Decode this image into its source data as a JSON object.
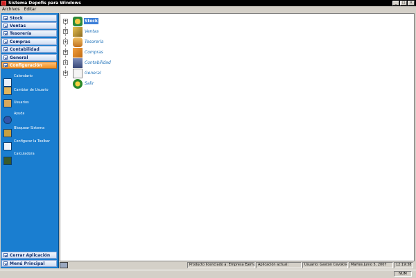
{
  "window": {
    "title": "Sistema Depofis para Windows"
  },
  "menu": {
    "items": [
      "Archivos",
      "Editar"
    ]
  },
  "sidebar": {
    "groups_top": [
      "Stock",
      "Ventas",
      "Tesorería",
      "Compras",
      "Contabilidad",
      "General",
      "Configuración"
    ],
    "items": [
      "Calendario",
      "Cambiar de Usuario",
      "Usuarios",
      "Ayuda",
      "Bloquear Sistema",
      "Configurar la Toolbar",
      "Calculadora"
    ],
    "groups_bottom": [
      "Cerrar Aplicación",
      "Menú Principal"
    ]
  },
  "tree": {
    "nodes": [
      "Stock",
      "Ventas",
      "Tesorería",
      "Compras",
      "Contabilidad",
      "General",
      "Salir"
    ],
    "selected": "Stock"
  },
  "status": {
    "license": "Producto licenciado a: Empresa Ejemplo S.A.",
    "app": "Aplicación actual:",
    "user": "Usuario: Gaston Cevoknesi",
    "date": "Martes Junio 5, 2007",
    "time": "12:19:38",
    "num": "NUM"
  },
  "colors": {
    "sidebar": "#1a7ed0",
    "active_group": "#f29022",
    "selected": "#3b7ed8",
    "tree_label": "#1a6fb8"
  }
}
